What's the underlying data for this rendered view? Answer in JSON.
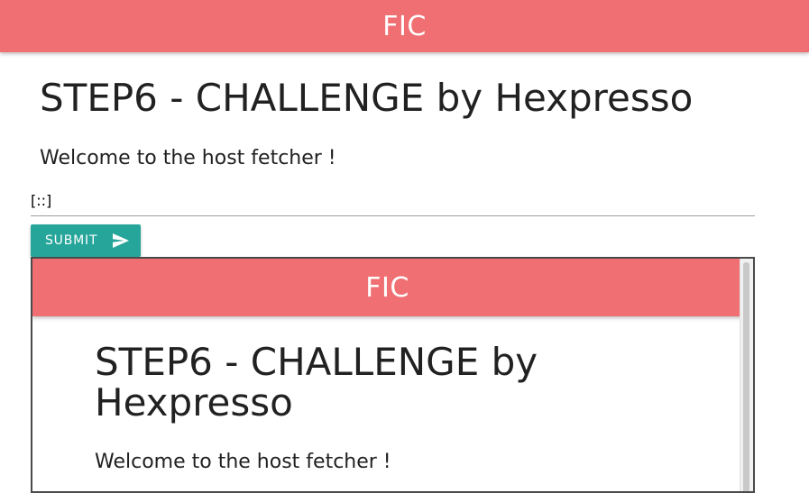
{
  "header": {
    "brand": "FIC"
  },
  "main": {
    "title": "STEP6 - CHALLENGE by Hexpresso",
    "welcome": "Welcome to the host fetcher !",
    "host_input": {
      "value": "[::]",
      "placeholder": ""
    },
    "submit_label": "SUBMIT",
    "submit_icon": "send-icon"
  },
  "result_frame": {
    "brand": "FIC",
    "title": "STEP6 - CHALLENGE by Hexpresso",
    "welcome": "Welcome to the host fetcher !"
  },
  "colors": {
    "header_bg": "#ef6f72",
    "button_bg": "#26a69a",
    "text": "#212121"
  }
}
